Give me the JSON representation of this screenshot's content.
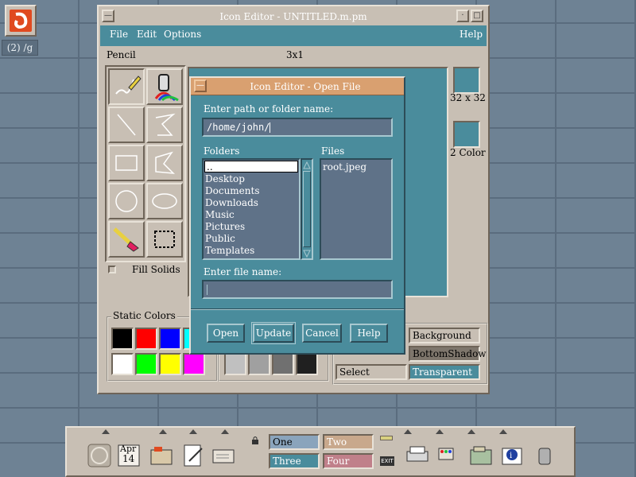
{
  "desktop": {
    "icon_name": "terminal-app-icon",
    "label": "(2) /g"
  },
  "window": {
    "title": "Icon Editor - UNTITLED.m.pm",
    "menus": {
      "file": "File",
      "edit": "Edit",
      "options": "Options",
      "help": "Help"
    },
    "current_tool": "Pencil",
    "grid_size": "3x1",
    "preview_large_label": "32 x 32",
    "preview_small_label": "2 Color",
    "fill_solids": {
      "label": "Fill Solids",
      "checked": false
    },
    "static_colors": {
      "label": "Static Colors",
      "colors": [
        "#000000",
        "#ff0000",
        "#0000ff",
        "#00ffff",
        "#ffffff",
        "#00ff00",
        "#ffff00",
        "#ff00ff"
      ]
    },
    "gray_colors": [
      "#c0c0c0",
      "#a0a0a0",
      "#707070",
      "#202020"
    ],
    "dynamic_colors": {
      "background": "Background",
      "bottom_shadow": "BottomShadow",
      "select": "Select",
      "transparent": "Transparent"
    },
    "tools": [
      "pencil",
      "spray",
      "line",
      "polyline",
      "rectangle",
      "polygon",
      "circle",
      "ellipse",
      "eraser",
      "select"
    ]
  },
  "dialog": {
    "title": "Icon Editor - Open File",
    "path_label": "Enter path or folder name:",
    "path_value": "/home/john/",
    "folders_label": "Folders",
    "files_label": "Files",
    "folders": [
      "..",
      "Desktop",
      "Documents",
      "Downloads",
      "Music",
      "Pictures",
      "Public",
      "Templates"
    ],
    "files": [
      "root.jpeg"
    ],
    "filename_label": "Enter file name:",
    "filename_value": "",
    "buttons": {
      "open": "Open",
      "update": "Update",
      "cancel": "Cancel",
      "help": "Help"
    }
  },
  "front_panel": {
    "calendar_month": "Apr",
    "calendar_day": "14",
    "workspaces": [
      "One",
      "Two",
      "Three",
      "Four"
    ],
    "exit_label": "EXIT"
  }
}
